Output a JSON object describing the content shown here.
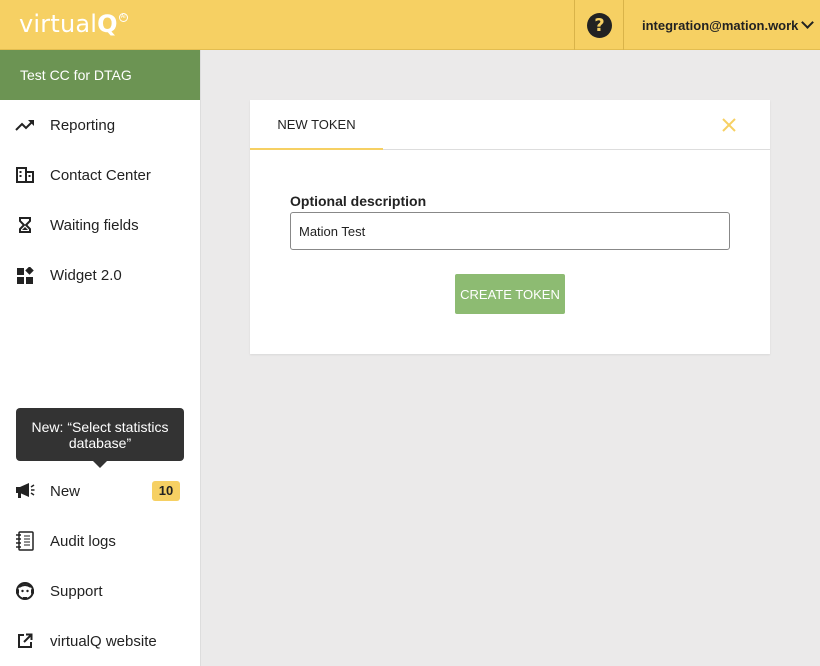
{
  "header": {
    "logo_text": "virtual",
    "logo_accent": "Q",
    "logo_badge": "AI",
    "help_symbol": "?",
    "user_email": "integration@mation.work"
  },
  "sidebar": {
    "org_name": "Test CC for DTAG",
    "top_items": [
      {
        "label": "Reporting",
        "icon": "trending-up-icon"
      },
      {
        "label": "Contact Center",
        "icon": "building-icon"
      },
      {
        "label": "Waiting fields",
        "icon": "hourglass-icon"
      },
      {
        "label": "Widget 2.0",
        "icon": "widgets-icon"
      }
    ],
    "tooltip": "New: “Select statistics database”",
    "bottom_items": [
      {
        "label": "New",
        "icon": "megaphone-icon",
        "badge": "10"
      },
      {
        "label": "Audit logs",
        "icon": "notebook-icon"
      },
      {
        "label": "Support",
        "icon": "support-agent-icon"
      },
      {
        "label": "virtualQ website",
        "icon": "external-link-icon"
      }
    ]
  },
  "card": {
    "tab_label": "NEW TOKEN",
    "field_label": "Optional description",
    "field_value": "Mation Test",
    "submit_label": "CREATE TOKEN"
  },
  "colors": {
    "header_bg": "#f6d063",
    "org_bg": "#6c9453",
    "button_bg": "#8dbb72",
    "page_bg": "#ebeaea",
    "accent": "#f6d063"
  }
}
